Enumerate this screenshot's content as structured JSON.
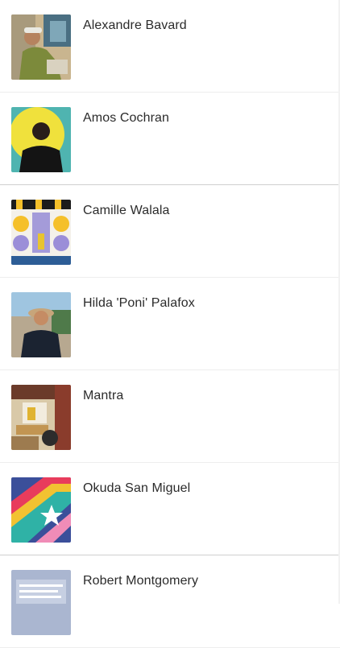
{
  "artists": [
    {
      "name": "Alexandre Bavard",
      "thumbnail": "photo-man-cap-painting"
    },
    {
      "name": "Amos Cochran",
      "thumbnail": "photo-man-yellow-sun-wall"
    },
    {
      "name": "Camille Walala",
      "thumbnail": "photo-geometric-mural"
    },
    {
      "name": "Hilda 'Poni' Palafox",
      "thumbnail": "photo-woman-hat-outdoors"
    },
    {
      "name": "Mantra",
      "thumbnail": "photo-street-scene"
    },
    {
      "name": "Okuda San Miguel",
      "thumbnail": "photo-rainbow-star-mural"
    },
    {
      "name": "Robert Montgomery",
      "thumbnail": "photo-text-billboard"
    }
  ]
}
